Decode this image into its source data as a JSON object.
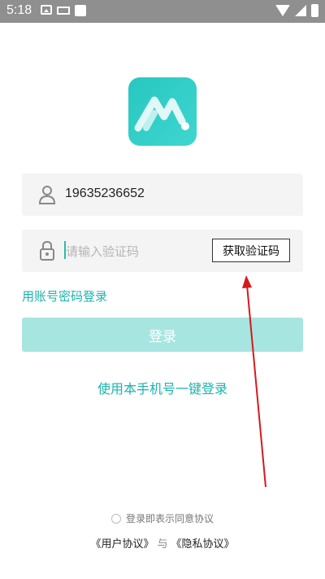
{
  "status_bar": {
    "time": "5:18"
  },
  "login": {
    "phone_value": "19635236652",
    "code_placeholder": "请输入验证码",
    "get_code_label": "获取验证码",
    "password_login_label": "用账号密码登录",
    "login_button_label": "登录",
    "one_key_login_label": "使用本手机号一键登录"
  },
  "footer": {
    "agree_text": "登录即表示同意协议",
    "user_agreement": "《用户协议》",
    "and_text": "与",
    "privacy_agreement": "《隐私协议》"
  },
  "colors": {
    "accent": "#1cb3ad",
    "button_disabled": "#a7e5e1",
    "arrow": "#d6191b"
  }
}
